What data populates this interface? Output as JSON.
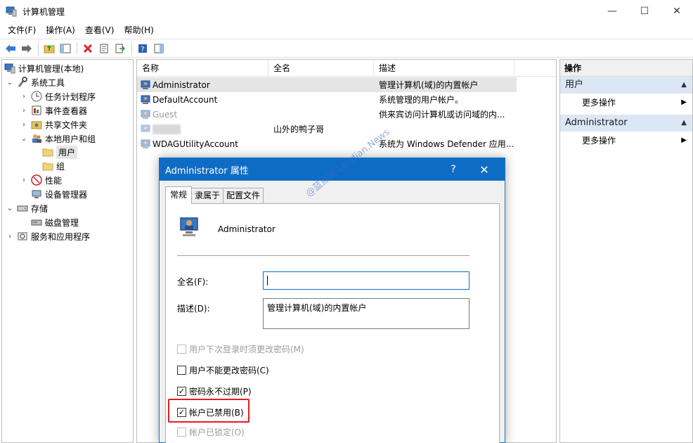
{
  "window": {
    "title": "计算机管理",
    "controls": [
      "—",
      "☐",
      "✕"
    ]
  },
  "menu": [
    {
      "label": "文件(F)"
    },
    {
      "label": "操作(A)"
    },
    {
      "label": "查看(V)"
    },
    {
      "label": "帮助(H)"
    }
  ],
  "tree": {
    "root": "计算机管理(本地)",
    "items": [
      {
        "label": "系统工具"
      },
      {
        "label": "任务计划程序"
      },
      {
        "label": "事件查看器"
      },
      {
        "label": "共享文件夹"
      },
      {
        "label": "本地用户和组"
      },
      {
        "label": "用户"
      },
      {
        "label": "组"
      },
      {
        "label": "性能"
      },
      {
        "label": "设备管理器"
      },
      {
        "label": "存储"
      },
      {
        "label": "磁盘管理"
      },
      {
        "label": "服务和应用程序"
      }
    ]
  },
  "list": {
    "columns": [
      "名称",
      "全名",
      "描述"
    ],
    "rows": [
      {
        "name": "Administrator",
        "fullname": "",
        "desc": "管理计算机(域)的内置帐户"
      },
      {
        "name": "DefaultAccount",
        "fullname": "",
        "desc": "系统管理的用户帐户。"
      },
      {
        "name": "Guest",
        "fullname": "",
        "desc": "供来宾访问计算机或访问域的内..."
      },
      {
        "name": "",
        "fullname": "山外的鸭子哥",
        "desc": ""
      },
      {
        "name": "WDAGUtilityAccount",
        "fullname": "",
        "desc": "系统为 Windows Defender 应用..."
      }
    ]
  },
  "actions": {
    "header": "操作",
    "sections": [
      {
        "title": "用户",
        "item": "更多操作"
      },
      {
        "title": "Administrator",
        "item": "更多操作"
      }
    ]
  },
  "dialog": {
    "title": "Administrator 属性",
    "help": "?",
    "close": "✕",
    "tabs": [
      "常规",
      "隶属于",
      "配置文件"
    ],
    "username": "Administrator",
    "fullname_label": "全名(F):",
    "fullname_value": "",
    "desc_label": "描述(D):",
    "desc_value": "管理计算机(域)的内置帐户",
    "checks": [
      {
        "label": "用户下次登录时须更改密码(M)",
        "checked": false,
        "disabled": true
      },
      {
        "label": "用户不能更改密码(C)",
        "checked": false,
        "disabled": false
      },
      {
        "label": "密码永不过期(P)",
        "checked": true,
        "disabled": false
      },
      {
        "label": "帐户已禁用(B)",
        "checked": true,
        "disabled": false
      },
      {
        "label": "帐户已锁定(O)",
        "checked": false,
        "disabled": true
      }
    ]
  },
  "watermark": "@蓝点网 Landian.News",
  "colors": {
    "dialog_title": "#0f6cc4",
    "highlight": "#e51c23",
    "action_section": "#dbe7f4"
  }
}
